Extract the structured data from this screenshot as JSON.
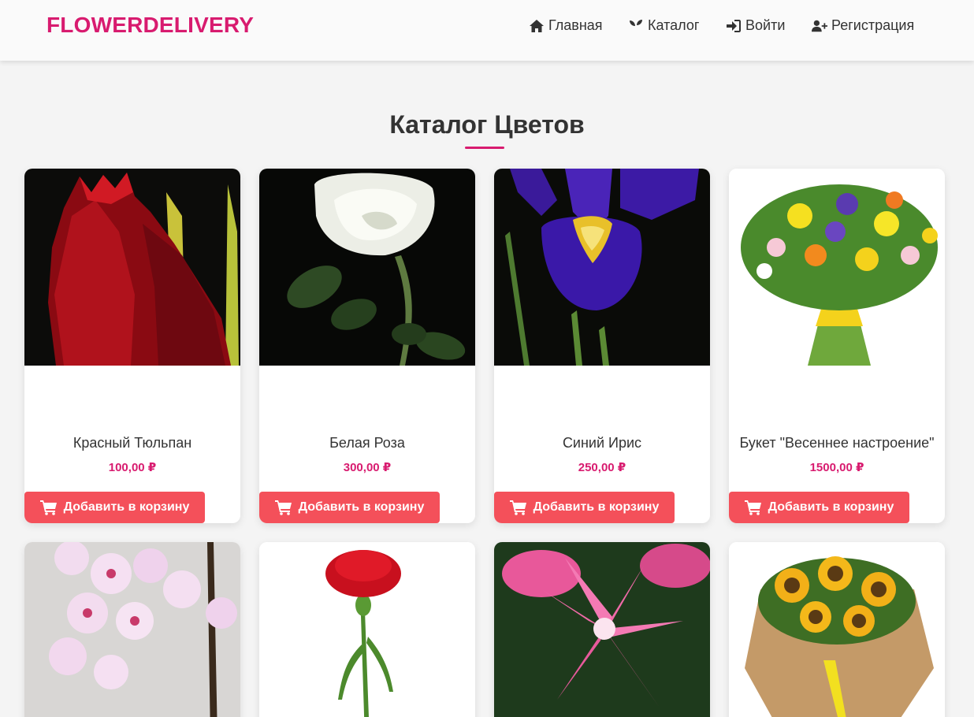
{
  "header": {
    "logo": "FLOWERDELIVERY",
    "nav": [
      {
        "label": "Главная",
        "icon": "home-icon"
      },
      {
        "label": "Каталог",
        "icon": "seedling-icon"
      },
      {
        "label": "Войти",
        "icon": "sign-in-icon"
      },
      {
        "label": "Регистрация",
        "icon": "user-plus-icon"
      }
    ]
  },
  "main": {
    "title": "Каталог Цветов",
    "products": [
      {
        "name": "Красный Тюльпан",
        "price": "100,00 ₽",
        "button": "Добавить в корзину"
      },
      {
        "name": "Белая Роза",
        "price": "300,00 ₽",
        "button": "Добавить в корзину"
      },
      {
        "name": "Синий Ирис",
        "price": "250,00 ₽",
        "button": "Добавить в корзину"
      },
      {
        "name": "Букет \"Весеннее настроение\"",
        "price": "1500,00 ₽",
        "button": "Добавить в корзину"
      }
    ]
  },
  "colors": {
    "brand": "#d81b6f",
    "button": "#f4505a",
    "background": "#f4f4f4"
  }
}
